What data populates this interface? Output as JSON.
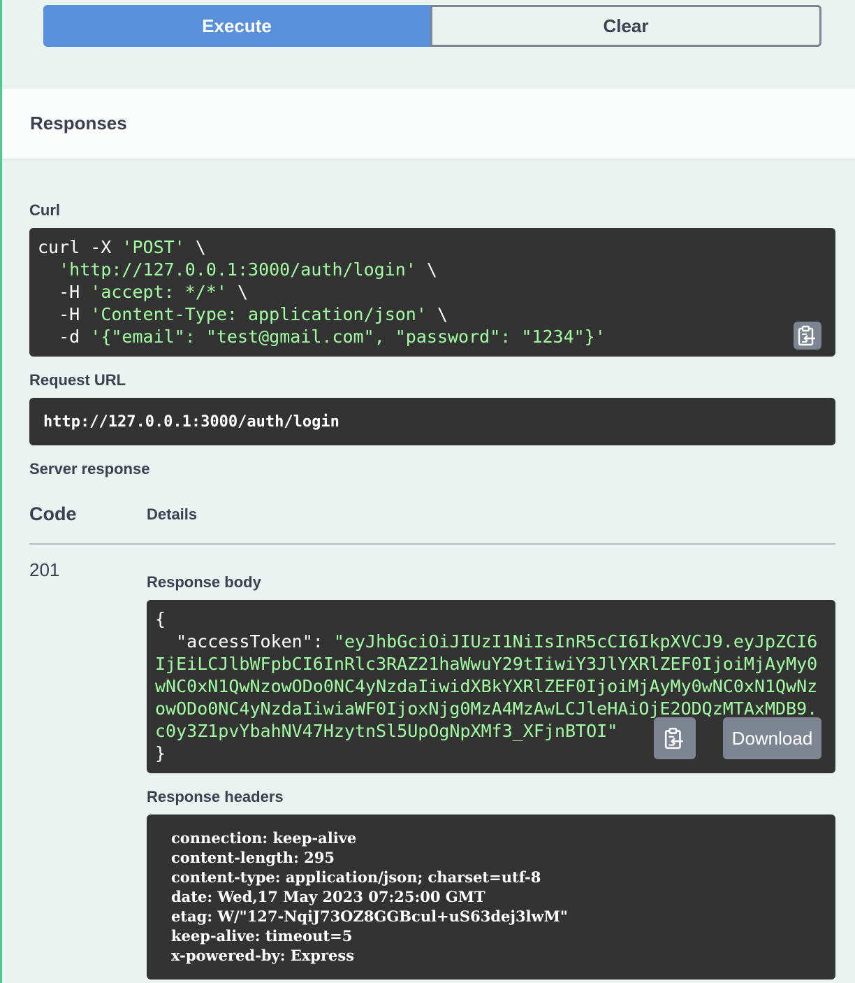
{
  "actions": {
    "execute_label": "Execute",
    "clear_label": "Clear"
  },
  "responses": {
    "title": "Responses"
  },
  "curl": {
    "label": "Curl",
    "cmd1": "curl -X ",
    "method": "'POST'",
    "cont": " \\",
    "indent": "  ",
    "url": "'http://127.0.0.1:3000/auth/login'",
    "h_flag": "-H ",
    "accept": "'accept: */*'",
    "content_type": "'Content-Type: application/json'",
    "d_flag": "-d ",
    "data": "'{\"email\": \"test@gmail.com\", \"password\": \"1234\"}'"
  },
  "request_url": {
    "label": "Request URL",
    "value": "http://127.0.0.1:3000/auth/login"
  },
  "server_response": {
    "label": "Server response",
    "col_code": "Code",
    "col_details": "Details",
    "code": "201",
    "response_body_label": "Response body",
    "body_open": "{",
    "body_key": "  \"accessToken\": ",
    "body_value": "\"eyJhbGciOiJIUzI1NiIsInR5cCI6IkpXVCJ9.eyJpZCI6IjEiLCJlbWFpbCI6InRlc3RAZ21haWwuY29tIiwiY3JlYXRlZEF0IjoiMjAyMy0wNC0xN1QwNzowODo0NC4yNzdaIiwidXBkYXRlZEF0IjoiMjAyMy0wNC0xN1QwNzowODo0NC4yNzdaIiwiaWF0IjoxNjg0MzA4MzAwLCJleHAiOjE2ODQzMTAxMDB9.c0y3Z1pvYbahNV47HzytnSl5UpOgNpXMf3_XFjnBTOI\"",
    "body_close": "}",
    "download_label": "Download",
    "response_headers_label": "Response headers",
    "headers": [
      "connection: keep-alive",
      "content-length: 295",
      "content-type: application/json; charset=utf-8",
      "date: Wed,17 May 2023 07:25:00 GMT",
      "etag: W/\"127-NqiJ73OZ8GGBcul+uS63dej3lwM\"",
      "keep-alive: timeout=5",
      "x-powered-by: Express"
    ]
  },
  "icons": {
    "copy": "clipboard-copy-icon"
  }
}
